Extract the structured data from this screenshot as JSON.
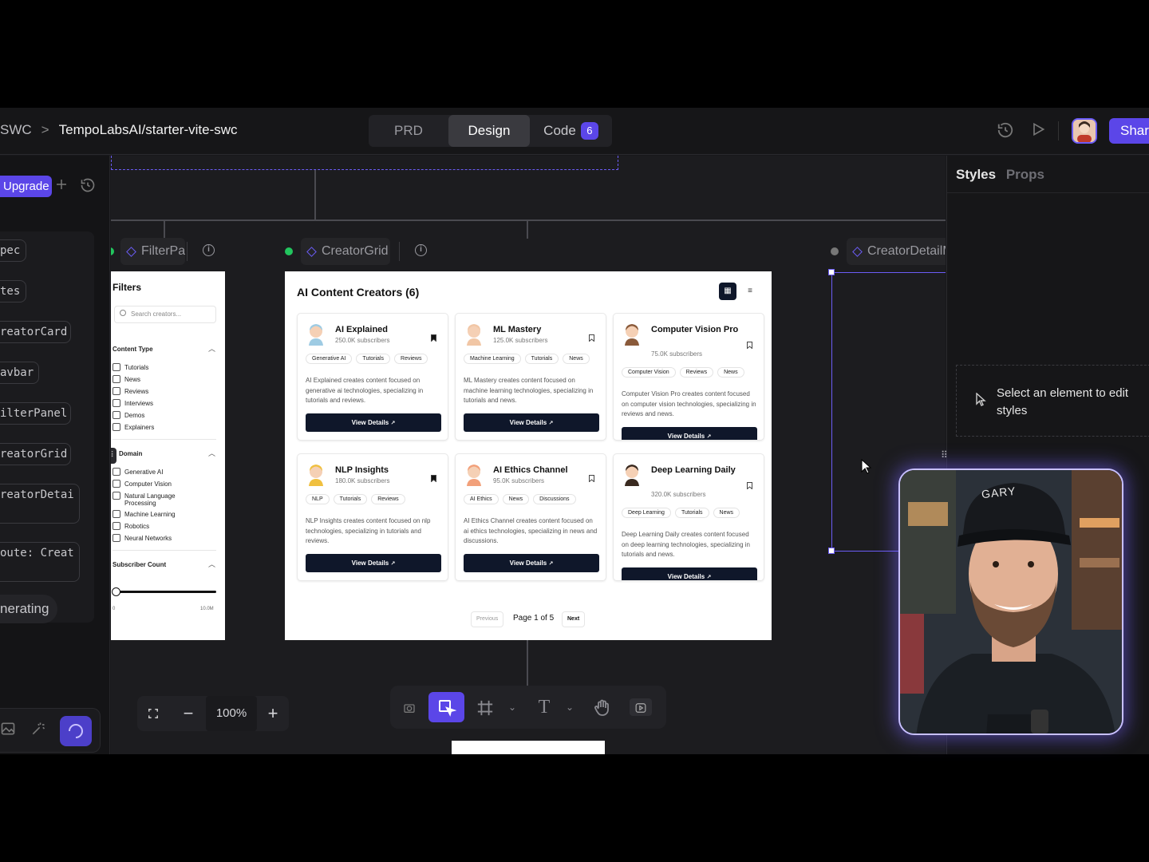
{
  "topbar": {
    "breadcrumb_parent": "SWC",
    "breadcrumb_separator": ">",
    "repo": "TempoLabsAI/starter-vite-swc",
    "modes": [
      "PRD",
      "Design",
      "Code"
    ],
    "code_badge": "6",
    "share_label": "Shar"
  },
  "leftbar": {
    "upgrade_label": "Upgrade",
    "layers": [
      "pec",
      "tes",
      "reatorCard",
      "avbar",
      "ilterPanel",
      "reatorGrid",
      "reatorDetai",
      "oute: Creat"
    ],
    "generating_label": "nerating"
  },
  "canvas": {
    "frames": [
      "FilterPa",
      "CreatorGrid",
      "CreatorDetailM"
    ],
    "zoom_level": "100%"
  },
  "filters": {
    "title": "Filters",
    "search_placeholder": "Search creators...",
    "content_type_label": "Content Type",
    "content_types": [
      "Tutorials",
      "News",
      "Reviews",
      "Interviews",
      "Demos",
      "Explainers"
    ],
    "domain_label": "Domain",
    "domains": [
      "Generative AI",
      "Computer Vision",
      "Natural Language Processing",
      "Machine Learning",
      "Robotics",
      "Neural Networks"
    ],
    "subscriber_label": "Subscriber Count",
    "slider_min": "0",
    "slider_max": "10.0M",
    "subscriber_value_fraction": 0.0
  },
  "grid": {
    "title": "AI Content Creators (6)",
    "view_details": "View Details",
    "cards": [
      {
        "name": "AI Explained",
        "subs": "250.0K subscribers",
        "tags": [
          "Generative AI",
          "Tutorials",
          "Reviews"
        ],
        "desc": "AI Explained creates content focused on generative ai technologies, specializing in tutorials and reviews.",
        "bookmarked": true
      },
      {
        "name": "ML Mastery",
        "subs": "125.0K subscribers",
        "tags": [
          "Machine Learning",
          "Tutorials",
          "News"
        ],
        "desc": "ML Mastery creates content focused on machine learning technologies, specializing in tutorials and news.",
        "bookmarked": false
      },
      {
        "name": "Computer Vision Pro",
        "subs": "75.0K subscribers",
        "tags": [
          "Computer Vision",
          "Reviews",
          "News"
        ],
        "desc": "Computer Vision Pro creates content focused on computer vision technologies, specializing in reviews and news.",
        "bookmarked": false
      },
      {
        "name": "NLP Insights",
        "subs": "180.0K subscribers",
        "tags": [
          "NLP",
          "Tutorials",
          "Reviews"
        ],
        "desc": "NLP Insights creates content focused on nlp technologies, specializing in tutorials and reviews.",
        "bookmarked": true
      },
      {
        "name": "AI Ethics Channel",
        "subs": "95.0K subscribers",
        "tags": [
          "AI Ethics",
          "News",
          "Discussions"
        ],
        "desc": "AI Ethics Channel creates content focused on ai ethics technologies, specializing in news and discussions.",
        "bookmarked": false
      },
      {
        "name": "Deep Learning Daily",
        "subs": "320.0K subscribers",
        "tags": [
          "Deep Learning",
          "Tutorials",
          "News"
        ],
        "desc": "Deep Learning Daily creates content focused on deep learning technologies, specializing in tutorials and news.",
        "bookmarked": false
      }
    ],
    "previous_label": "Previous",
    "page_label": "Page 1 of 5",
    "next_label": "Next"
  },
  "rightpanel": {
    "tab_styles": "Styles",
    "tab_props": "Props",
    "empty_message": "Select an element to edit styles"
  },
  "webcam": {
    "cap_text": "GARY"
  },
  "colors": {
    "accent": "#5b46e8",
    "canvas_bg": "#1c1c1f",
    "button_dark": "#0f172a"
  }
}
